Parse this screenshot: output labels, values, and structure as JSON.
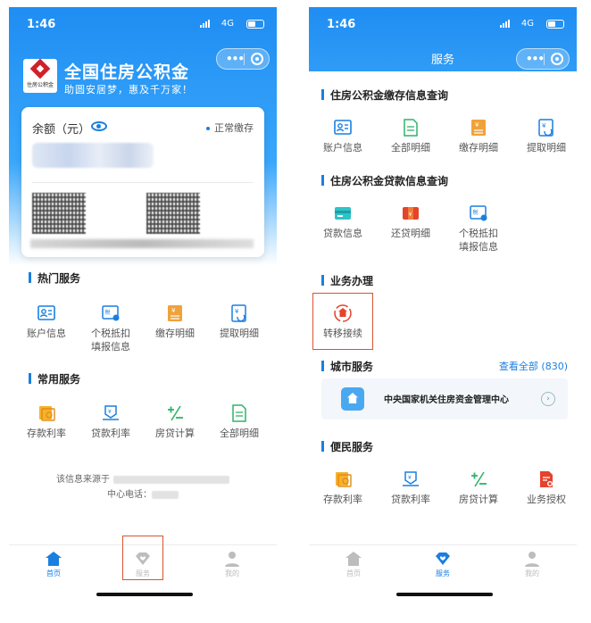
{
  "left": {
    "status": {
      "time": "1:46",
      "network": "4G"
    },
    "header": {
      "title": "全国住房公积金",
      "slogan": "助圆安居梦，惠及千万家！",
      "logo_text": "住房公积金"
    },
    "card": {
      "balance_label": "余额（元）",
      "status": "正常缴存"
    },
    "hot_services": {
      "title": "热门服务",
      "items": [
        {
          "label": "账户信息",
          "icon": "id-card-icon"
        },
        {
          "label": "个税抵扣\n填报信息",
          "icon": "tax-icon"
        },
        {
          "label": "缴存明细",
          "icon": "deposit-ledger-icon"
        },
        {
          "label": "提取明细",
          "icon": "withdraw-icon"
        }
      ]
    },
    "common_services": {
      "title": "常用服务",
      "items": [
        {
          "label": "存款利率",
          "icon": "deposit-rate-icon"
        },
        {
          "label": "贷款利率",
          "icon": "loan-rate-icon"
        },
        {
          "label": "房贷计算",
          "icon": "calculator-icon"
        },
        {
          "label": "全部明细",
          "icon": "document-icon"
        }
      ]
    },
    "footer": {
      "source_label": "该信息来源于",
      "phone_label": "中心电话："
    },
    "tabbar": {
      "home": "首页",
      "service": "服务",
      "mine": "我的"
    }
  },
  "right": {
    "status": {
      "time": "1:46",
      "network": "4G"
    },
    "header": {
      "title": "服务"
    },
    "deposit_query": {
      "title": "住房公积金缴存信息查询",
      "items": [
        {
          "label": "账户信息"
        },
        {
          "label": "全部明细"
        },
        {
          "label": "缴存明细"
        },
        {
          "label": "提取明细"
        }
      ]
    },
    "loan_query": {
      "title": "住房公积金贷款信息查询",
      "items": [
        {
          "label": "贷款信息"
        },
        {
          "label": "还贷明细"
        },
        {
          "label": "个税抵扣\n填报信息"
        }
      ]
    },
    "business": {
      "title": "业务办理",
      "items": [
        {
          "label": "转移接续"
        }
      ]
    },
    "city": {
      "title": "城市服务",
      "view_all": "查看全部 (830)",
      "center_name": "中央国家机关住房资金管理中心"
    },
    "convenience": {
      "title": "便民服务",
      "items": [
        {
          "label": "存款利率"
        },
        {
          "label": "贷款利率"
        },
        {
          "label": "房贷计算"
        },
        {
          "label": "业务授权"
        }
      ]
    },
    "tabbar": {
      "home": "首页",
      "service": "服务",
      "mine": "我的"
    }
  },
  "colors": {
    "primary": "#1a7fe0",
    "highlight_box": "#d9542f",
    "logo_red": "#d0202a",
    "icon_orange": "#f0a23a",
    "icon_red": "#e4432d"
  }
}
